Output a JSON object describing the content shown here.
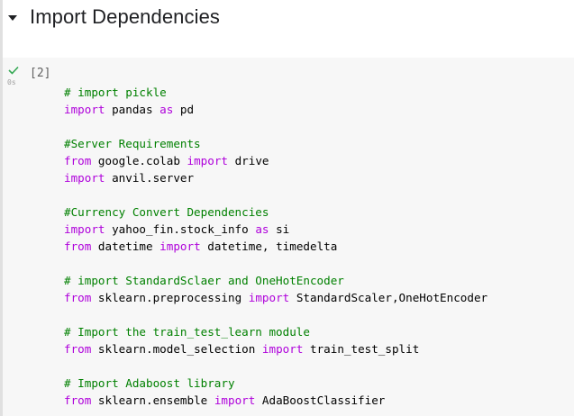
{
  "section": {
    "title": "Import Dependencies"
  },
  "cell": {
    "execution_count": "[2]",
    "execution_time": "0s",
    "status_icon": "check-icon",
    "lines": [
      [
        {
          "t": "c",
          "v": "# import pickle"
        }
      ],
      [
        {
          "t": "k",
          "v": "import"
        },
        {
          "t": "n",
          "v": " pandas "
        },
        {
          "t": "k",
          "v": "as"
        },
        {
          "t": "n",
          "v": " pd"
        }
      ],
      [],
      [
        {
          "t": "c",
          "v": "#Server Requirements"
        }
      ],
      [
        {
          "t": "k",
          "v": "from"
        },
        {
          "t": "n",
          "v": " google.colab "
        },
        {
          "t": "k",
          "v": "import"
        },
        {
          "t": "n",
          "v": " drive"
        }
      ],
      [
        {
          "t": "k",
          "v": "import"
        },
        {
          "t": "n",
          "v": " anvil.server"
        }
      ],
      [],
      [
        {
          "t": "c",
          "v": "#Currency Convert Dependencies"
        }
      ],
      [
        {
          "t": "k",
          "v": "import"
        },
        {
          "t": "n",
          "v": " yahoo_fin.stock_info "
        },
        {
          "t": "k",
          "v": "as"
        },
        {
          "t": "n",
          "v": " si"
        }
      ],
      [
        {
          "t": "k",
          "v": "from"
        },
        {
          "t": "n",
          "v": " datetime "
        },
        {
          "t": "k",
          "v": "import"
        },
        {
          "t": "n",
          "v": " datetime, timedelta"
        }
      ],
      [],
      [
        {
          "t": "c",
          "v": "# import StandardSclaer and OneHotEncoder"
        }
      ],
      [
        {
          "t": "k",
          "v": "from"
        },
        {
          "t": "n",
          "v": " sklearn.preprocessing "
        },
        {
          "t": "k",
          "v": "import"
        },
        {
          "t": "n",
          "v": " StandardScaler,OneHotEncoder"
        }
      ],
      [],
      [
        {
          "t": "c",
          "v": "# Import the train_test_learn module"
        }
      ],
      [
        {
          "t": "k",
          "v": "from"
        },
        {
          "t": "n",
          "v": " sklearn.model_selection "
        },
        {
          "t": "k",
          "v": "import"
        },
        {
          "t": "n",
          "v": " train_test_split"
        }
      ],
      [],
      [
        {
          "t": "c",
          "v": "# Import Adaboost library"
        }
      ],
      [
        {
          "t": "k",
          "v": "from"
        },
        {
          "t": "n",
          "v": " sklearn.ensemble "
        },
        {
          "t": "k",
          "v": "import"
        },
        {
          "t": "n",
          "v": " AdaBoostClassifier"
        }
      ]
    ]
  },
  "colors": {
    "comment": "#008000",
    "keyword": "#af00db",
    "success": "#34a853"
  }
}
